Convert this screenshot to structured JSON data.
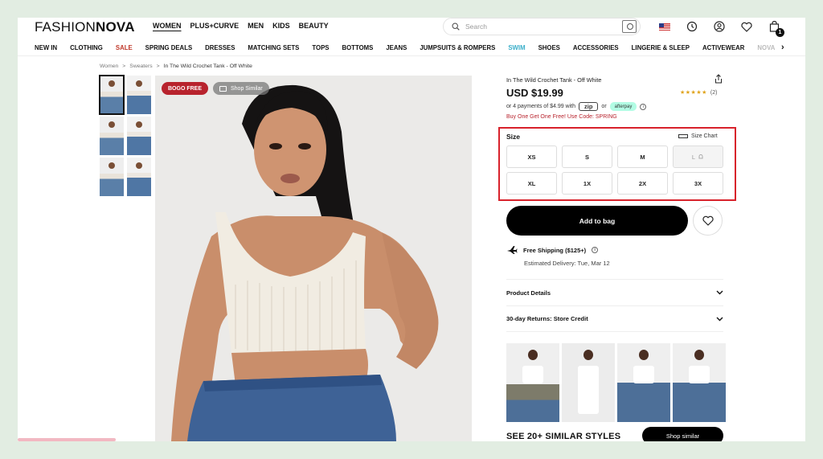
{
  "brand": {
    "logo_light": "FASHION",
    "logo_bold": "NOVA"
  },
  "topnav": [
    {
      "label": "WOMEN",
      "active": true
    },
    {
      "label": "PLUS+CURVE"
    },
    {
      "label": "MEN"
    },
    {
      "label": "KIDS"
    },
    {
      "label": "BEAUTY"
    }
  ],
  "search": {
    "placeholder": "Search"
  },
  "header_icons": [
    "us-flag-icon",
    "history-icon",
    "account-icon",
    "heart-icon",
    "bag-icon"
  ],
  "cart": {
    "count": "1"
  },
  "categories": [
    "NEW IN",
    "CLOTHING",
    "SALE",
    "SPRING DEALS",
    "DRESSES",
    "MATCHING SETS",
    "TOPS",
    "BOTTOMS",
    "JEANS",
    "JUMPSUITS & ROMPERS",
    "SWIM",
    "SHOES",
    "ACCESSORIES",
    "LINGERIE & SLEEP",
    "ACTIVEWEAR",
    "NOVA"
  ],
  "breadcrumb": [
    "Women",
    "Sweaters",
    "In The Wild Crochet Tank - Off White"
  ],
  "image_badges": {
    "bogo": "BOGO FREE",
    "similar": "Shop Similar"
  },
  "product": {
    "title": "In The Wild Crochet Tank - Off White",
    "price": "USD $19.99",
    "rating_stars": "★★★★★",
    "rating_count": "(2)",
    "payments_text": "or 4 payments of $4.99 with",
    "zip_label": "zip",
    "or_label": "or",
    "afterpay_label": "afterpay",
    "promo": "Buy One Get One Free! Use Code: SPRING"
  },
  "size": {
    "label": "Size",
    "chart_label": "Size Chart",
    "options": [
      {
        "label": "XS"
      },
      {
        "label": "S"
      },
      {
        "label": "M"
      },
      {
        "label": "L",
        "out_of_stock": true
      },
      {
        "label": "XL"
      },
      {
        "label": "1X"
      },
      {
        "label": "2X"
      },
      {
        "label": "3X"
      }
    ]
  },
  "actions": {
    "add_to_bag": "Add to bag"
  },
  "shipping": {
    "title": "Free Shipping ($125+)",
    "estimate": "Estimated Delivery: Tue, Mar 12"
  },
  "accordions": [
    "Product Details",
    "30-day Returns: Store Credit"
  ],
  "similar": {
    "title": "SEE 20+ SIMILAR STYLES",
    "button": "Shop similar"
  },
  "colors": {
    "accent_red": "#b8232d",
    "highlight_box": "#d8222b",
    "swim": "#3aaec9"
  }
}
